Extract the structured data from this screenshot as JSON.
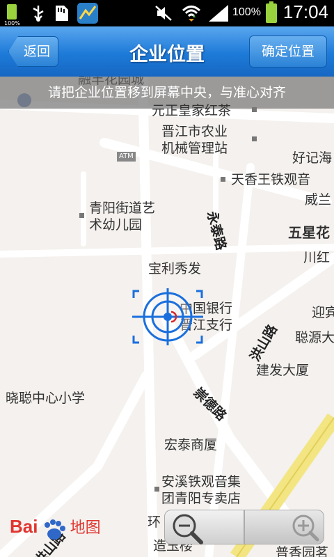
{
  "status_bar": {
    "battery_small_pct": "100%",
    "battery_pct": "100%",
    "time": "17:04",
    "icons": [
      "battery-icon",
      "usb-icon",
      "sd-card-icon",
      "app-notification-icon",
      "mute-icon",
      "wifi-icon",
      "signal-icon",
      "battery-full-icon"
    ]
  },
  "header": {
    "back_label": "返回",
    "title": "企业位置",
    "confirm_label": "确定位置"
  },
  "map": {
    "hint": "请把企业位置移到屏幕中央，与准心对齐",
    "poi": {
      "top_cut": "融丰花园城",
      "p1": "元正皇家红茶",
      "p2a": "晋江市农业",
      "p2b": "机械管理站",
      "p3": "好记海",
      "p4": "天香王铁观音",
      "p5": "威兰",
      "p6a": "青阳街道艺",
      "p6b": "术幼儿园",
      "p7": "五星花",
      "p8": "川红",
      "p9": "宝利秀发",
      "p10a": "中国银行",
      "p10b": "晋江支行",
      "p11": "迎宾",
      "p12": "聪源大",
      "p13": "建发大厦",
      "p14": "晓聪中心小学",
      "p15": "宏泰商厦",
      "p16a": "安溪铁观音集",
      "p16b": "团青阳专卖店",
      "p17": "环",
      "p18": "造玉楼",
      "p19": "普香园茗"
    },
    "roads": {
      "r1": "永泰路",
      "r2": "洪山路",
      "r3": "崇德路",
      "r4": "洪山路"
    },
    "atm_label": "ATM",
    "logo_bai": "Bai",
    "logo_map": "地图"
  }
}
